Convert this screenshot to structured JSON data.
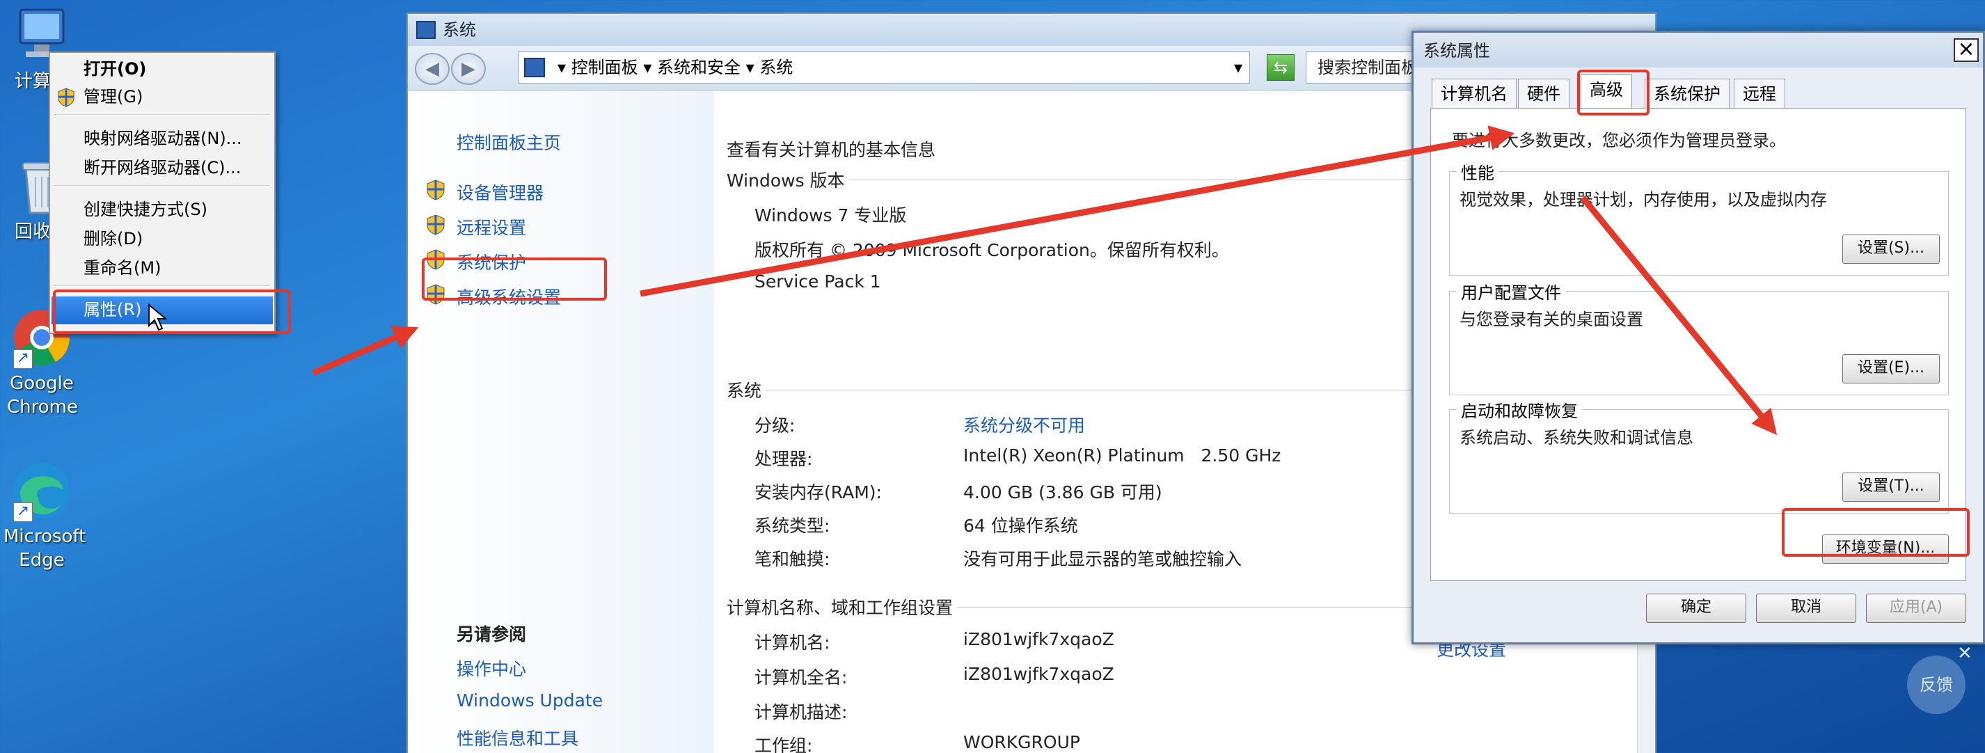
{
  "desktop": {
    "icons": [
      {
        "label": "计算机"
      },
      {
        "label": "回收站"
      },
      {
        "label": "Google Chrome"
      },
      {
        "label": "Microsoft Edge"
      }
    ]
  },
  "context_menu": {
    "items": [
      "打开(O)",
      "管理(G)",
      "映射网络驱动器(N)...",
      "断开网络驱动器(C)...",
      "创建快捷方式(S)",
      "删除(D)",
      "重命名(M)",
      "属性(R)"
    ]
  },
  "system_window": {
    "title": "系统",
    "breadcrumb": [
      "控制面板",
      "系统和安全",
      "系统"
    ],
    "search_placeholder": "搜索控制面板",
    "sidebar": {
      "home": "控制面板主页",
      "links": [
        "设备管理器",
        "远程设置",
        "系统保护",
        "高级系统设置"
      ],
      "see_also_title": "另请参阅",
      "see_also": [
        "操作中心",
        "Windows Update",
        "性能信息和工具"
      ]
    },
    "main": {
      "heading": "查看有关计算机的基本信息",
      "edition_section": "Windows 版本",
      "edition": "Windows 7 专业版",
      "copyright": "版权所有 © 2009 Microsoft Corporation。保留所有权利。",
      "service_pack": "Service Pack 1",
      "system_section": "系统",
      "system_rows": [
        {
          "label": "分级:",
          "value": "系统分级不可用"
        },
        {
          "label": "处理器:",
          "value": "Intel(R) Xeon(R) Platinum   2.50 GHz"
        },
        {
          "label": "安装内存(RAM):",
          "value": "4.00 GB (3.86 GB 可用)"
        },
        {
          "label": "系统类型:",
          "value": "64 位操作系统"
        },
        {
          "label": "笔和触摸:",
          "value": "没有可用于此显示器的笔或触控输入"
        }
      ],
      "computer_section": "计算机名称、域和工作组设置",
      "computer_rows": [
        {
          "label": "计算机名:",
          "value": "iZ801wjfk7xqaoZ"
        },
        {
          "label": "计算机全名:",
          "value": "iZ801wjfk7xqaoZ"
        },
        {
          "label": "计算机描述:",
          "value": ""
        },
        {
          "label": "工作组:",
          "value": "WORKGROUP"
        }
      ],
      "change_settings": "更改设置"
    }
  },
  "dialog": {
    "title": "系统属性",
    "tabs": [
      "计算机名",
      "硬件",
      "高级",
      "系统保护",
      "远程"
    ],
    "admin_note": "要进行大多数更改，您必须作为管理员登录。",
    "groups": [
      {
        "title": "性能",
        "desc": "视觉效果，处理器计划，内存使用，以及虚拟内存",
        "button": "设置(S)..."
      },
      {
        "title": "用户配置文件",
        "desc": "与您登录有关的桌面设置",
        "button": "设置(E)..."
      },
      {
        "title": "启动和故障恢复",
        "desc": "系统启动、系统失败和调试信息",
        "button": "设置(T)..."
      }
    ],
    "env_button": "环境变量(N)...",
    "ok": "确定",
    "cancel": "取消",
    "apply": "应用(A)"
  },
  "feedback": "反馈",
  "colors": {
    "annotation": "#e4392a",
    "link": "#1b5bb8"
  }
}
